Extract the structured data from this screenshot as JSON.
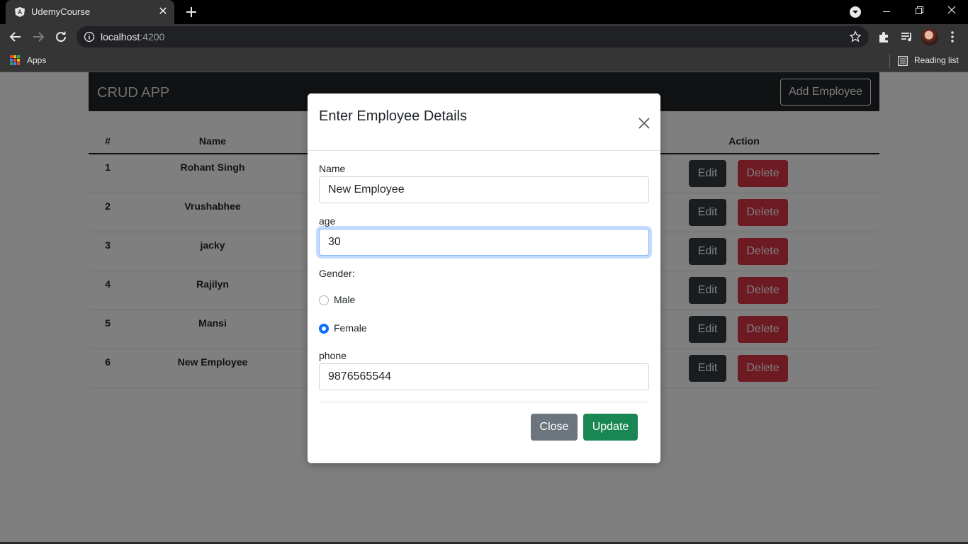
{
  "browser": {
    "tab_title": "UdemyCourse",
    "tab_close": "✕",
    "url_host": "localhost",
    "url_port": ":4200",
    "bookmarks": {
      "apps_label": "Apps",
      "reading_list_label": "Reading list"
    }
  },
  "app": {
    "brand": "CRUD APP",
    "add_button": "Add Employee",
    "table": {
      "headers": {
        "index": "#",
        "name": "Name",
        "action": "Action"
      },
      "rows": [
        {
          "index": "1",
          "name": "Rohant Singh"
        },
        {
          "index": "2",
          "name": "Vrushabhee"
        },
        {
          "index": "3",
          "name": "jacky"
        },
        {
          "index": "4",
          "name": "Rajilyn"
        },
        {
          "index": "5",
          "name": "Mansi"
        },
        {
          "index": "6",
          "name": "New Employee"
        }
      ],
      "edit_label": "Edit",
      "delete_label": "Delete"
    }
  },
  "modal": {
    "title": "Enter Employee Details",
    "name_label": "Name",
    "name_value": "New Employee",
    "age_label": "age",
    "age_value": "30",
    "gender_label": "Gender:",
    "gender_options": [
      {
        "label": "Male",
        "checked": false
      },
      {
        "label": "Female",
        "checked": true
      }
    ],
    "phone_label": "phone",
    "phone_value": "9876565544",
    "close_button": "Close",
    "update_button": "Update"
  },
  "colors": {
    "primary": "#0d6efd",
    "danger": "#dc3545",
    "success": "#198754",
    "secondary": "#6c757d",
    "dark": "#343a40"
  }
}
